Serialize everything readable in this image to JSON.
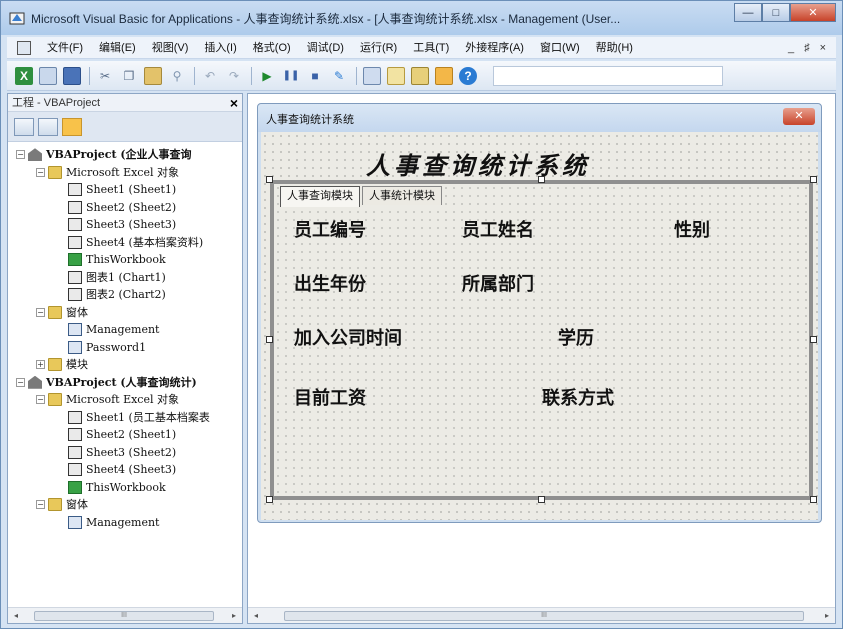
{
  "window": {
    "title": "Microsoft Visual Basic for Applications - 人事查询统计系统.xlsx - [人事查询统计系统.xlsx - Management (User...",
    "minimize": "—",
    "maximize": "□",
    "close": "✕"
  },
  "menubar": {
    "items": [
      "文件(F)",
      "编辑(E)",
      "视图(V)",
      "插入(I)",
      "格式(O)",
      "调试(D)",
      "运行(R)",
      "工具(T)",
      "外接程序(A)",
      "窗口(W)",
      "帮助(H)"
    ],
    "mdi_minimize": "_",
    "mdi_restore": "♯",
    "mdi_close": "×"
  },
  "toolbar": {
    "icons": [
      "excel-icon",
      "insert-form-icon",
      "save-icon",
      "cut-icon",
      "copy-icon",
      "paste-icon",
      "find-icon",
      "undo-icon",
      "redo-icon",
      "run-icon",
      "break-icon",
      "reset-icon",
      "design-mode-icon",
      "project-explorer-icon",
      "properties-icon",
      "object-browser-icon",
      "toolbox-icon",
      "help-icon"
    ],
    "accent": "#2a7bd3"
  },
  "project_pane": {
    "title": "工程 - VBAProject",
    "close": "×",
    "tree": [
      {
        "level": 0,
        "twisty": "−",
        "icon": "proj",
        "label": "VBAProject (企业人事查询",
        "bold": true
      },
      {
        "level": 1,
        "twisty": "−",
        "icon": "folder",
        "label": "Microsoft Excel 对象"
      },
      {
        "level": 2,
        "twisty": "",
        "icon": "sheet",
        "label": "Sheet1 (Sheet1)"
      },
      {
        "level": 2,
        "twisty": "",
        "icon": "sheet",
        "label": "Sheet2 (Sheet2)"
      },
      {
        "level": 2,
        "twisty": "",
        "icon": "sheet",
        "label": "Sheet3 (Sheet3)"
      },
      {
        "level": 2,
        "twisty": "",
        "icon": "sheet",
        "label": "Sheet4 (基本档案资料)"
      },
      {
        "level": 2,
        "twisty": "",
        "icon": "wb",
        "label": "ThisWorkbook"
      },
      {
        "level": 2,
        "twisty": "",
        "icon": "sheet",
        "label": "图表1 (Chart1)"
      },
      {
        "level": 2,
        "twisty": "",
        "icon": "sheet",
        "label": "图表2 (Chart2)"
      },
      {
        "level": 1,
        "twisty": "−",
        "icon": "folder",
        "label": "窗体"
      },
      {
        "level": 2,
        "twisty": "",
        "icon": "form",
        "label": "Management"
      },
      {
        "level": 2,
        "twisty": "",
        "icon": "form",
        "label": "Password1"
      },
      {
        "level": 1,
        "twisty": "+",
        "icon": "folder",
        "label": "模块"
      },
      {
        "level": 0,
        "twisty": "−",
        "icon": "proj",
        "label": "VBAProject (人事查询统计)",
        "bold": true
      },
      {
        "level": 1,
        "twisty": "−",
        "icon": "folder",
        "label": "Microsoft Excel 对象"
      },
      {
        "level": 2,
        "twisty": "",
        "icon": "sheet",
        "label": "Sheet1 (员工基本档案表"
      },
      {
        "level": 2,
        "twisty": "",
        "icon": "sheet",
        "label": "Sheet2 (Sheet1)"
      },
      {
        "level": 2,
        "twisty": "",
        "icon": "sheet",
        "label": "Sheet3 (Sheet2)"
      },
      {
        "level": 2,
        "twisty": "",
        "icon": "sheet",
        "label": "Sheet4 (Sheet3)"
      },
      {
        "level": 2,
        "twisty": "",
        "icon": "wb",
        "label": "ThisWorkbook"
      },
      {
        "level": 1,
        "twisty": "−",
        "icon": "folder",
        "label": "窗体"
      },
      {
        "level": 2,
        "twisty": "",
        "icon": "form",
        "label": "Management"
      }
    ]
  },
  "scroll": {
    "left_arrow": "◂",
    "right_arrow": "▸",
    "thumb_grip": "III"
  },
  "userform": {
    "window_title": "人事查询统计系统",
    "close": "✕",
    "heading": "人事查询统计系统",
    "tabs": [
      "人事查询模块",
      "人事统计模块"
    ],
    "labels": {
      "emp_id": "员工编号",
      "emp_name": "员工姓名",
      "gender": "性别",
      "birth_year": "出生年份",
      "department": "所属部门",
      "join_date": "加入公司时间",
      "education": "学历",
      "salary": "目前工资",
      "contact": "联系方式"
    }
  }
}
